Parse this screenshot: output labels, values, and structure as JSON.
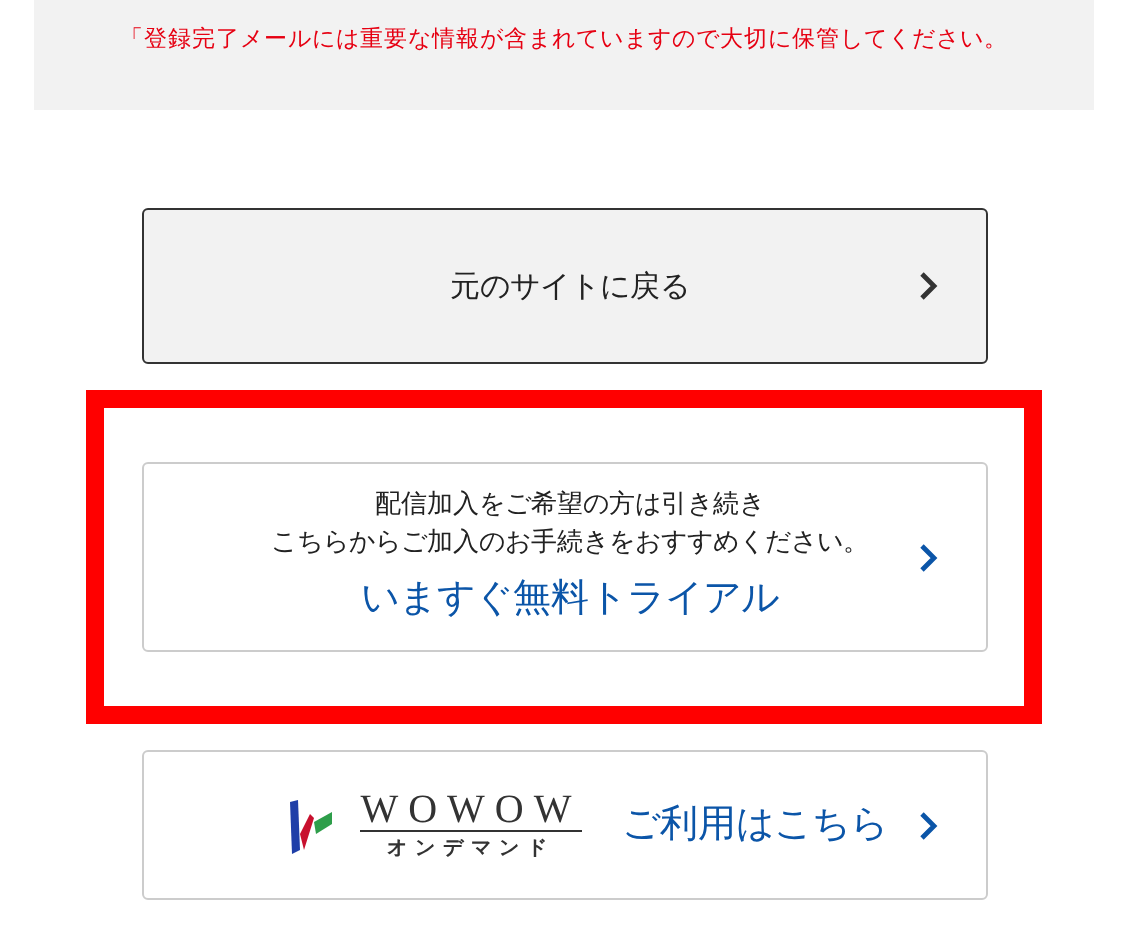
{
  "notice": {
    "text": "「登録完了メールには重要な情報が含まれていますので大切に保管してください。"
  },
  "buttons": [
    {
      "kind": "plain",
      "label": "元のサイトに戻る",
      "highlighted": false
    },
    {
      "kind": "trial",
      "description_lines": [
        "配信加入をご希望の方は引き続き",
        "こちらからご加入のお手続きをおすすめください。"
      ],
      "label": "いますぐ無料トライアル",
      "highlighted": true
    },
    {
      "kind": "logo",
      "logo_title": "WOWOW",
      "logo_subtitle": "オンデマンド",
      "label": "ご利用はこちら",
      "highlighted": false
    }
  ]
}
